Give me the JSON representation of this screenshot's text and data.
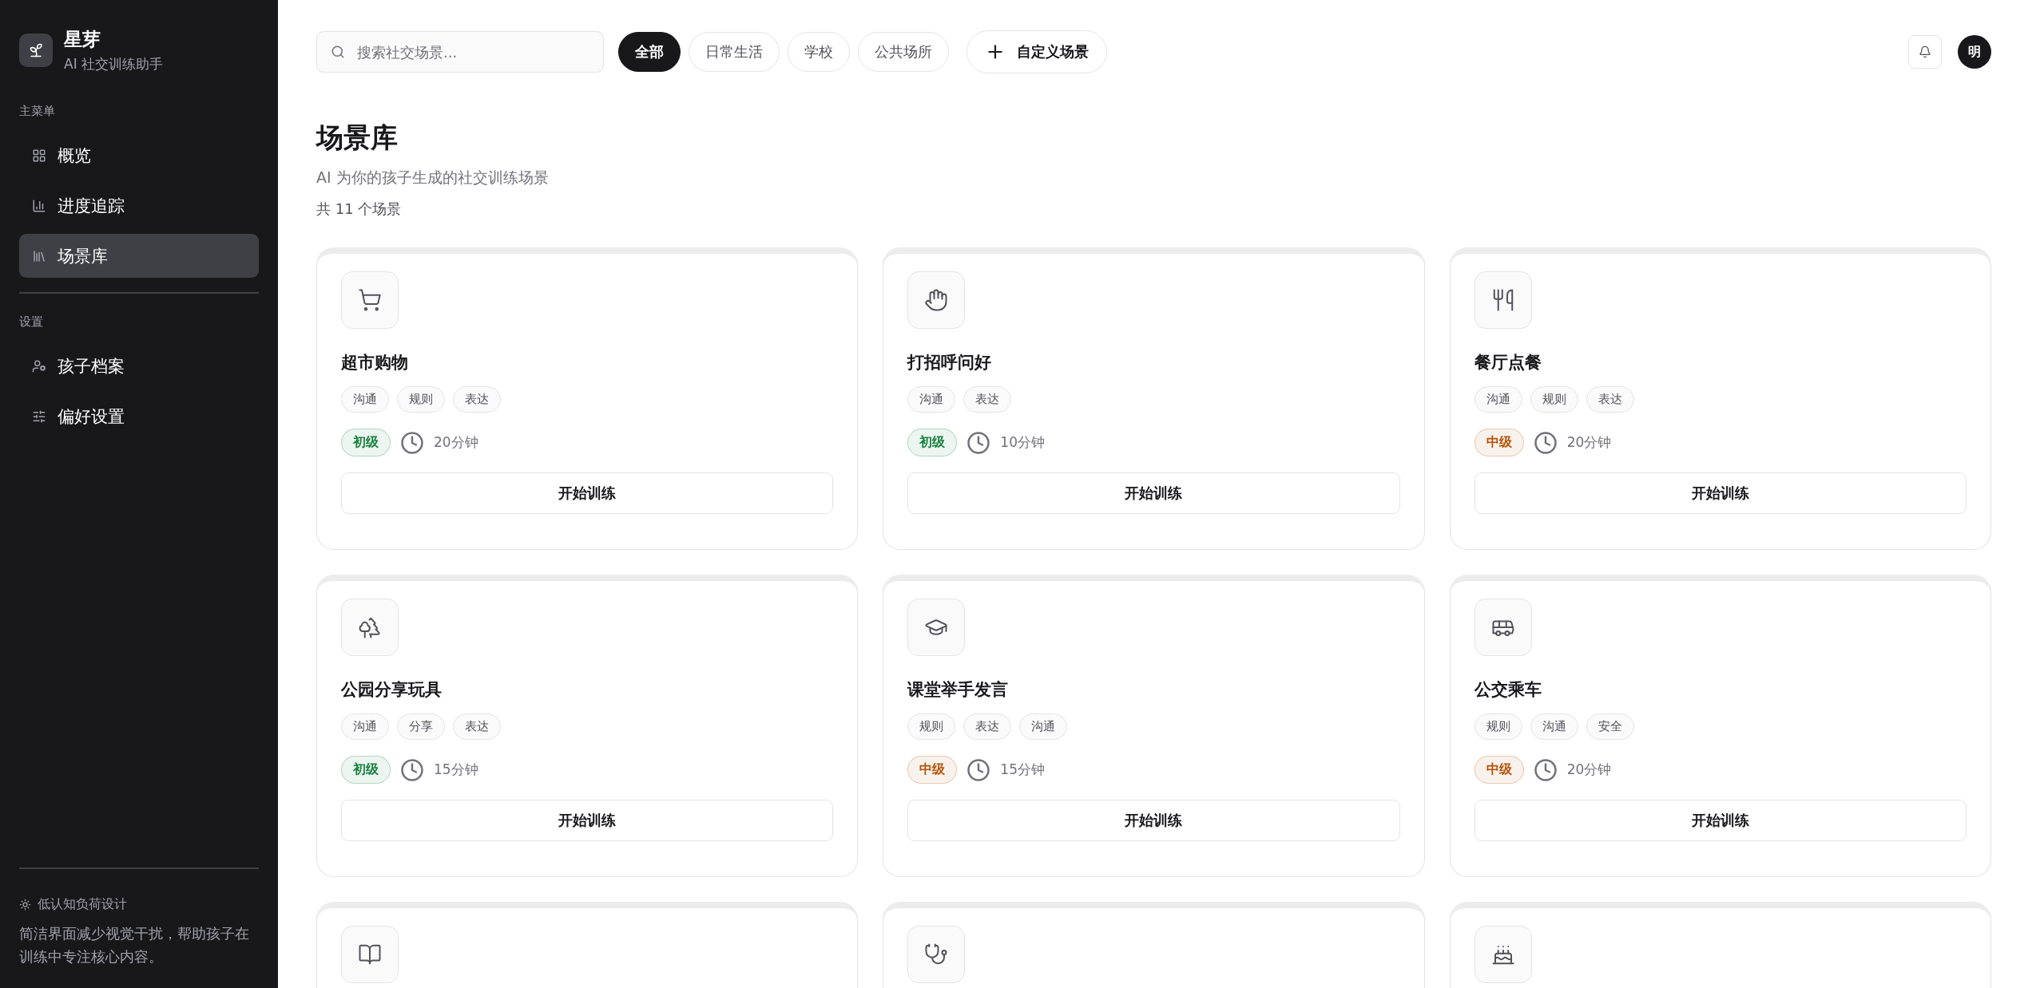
{
  "sidebar": {
    "brand": {
      "name": "星芽",
      "tagline": "AI 社交训练助手"
    },
    "sections": [
      {
        "heading": "主菜单",
        "items": [
          {
            "label": "概览",
            "selected": false
          },
          {
            "label": "进度追踪",
            "selected": false
          },
          {
            "label": "场景库",
            "selected": true
          }
        ]
      },
      {
        "heading": "设置",
        "items": [
          {
            "label": "孩子档案",
            "selected": false
          },
          {
            "label": "偏好设置",
            "selected": false
          }
        ]
      }
    ],
    "footer": {
      "title": "低认知负荷设计",
      "text": "简洁界面减少视觉干扰，帮助孩子在训练中专注核心内容。"
    }
  },
  "toolbar": {
    "search": {
      "placeholder": "搜索社交场景..."
    },
    "filters": [
      {
        "label": "全部",
        "selected": true
      },
      {
        "label": "日常生活",
        "selected": false
      },
      {
        "label": "学校",
        "selected": false
      },
      {
        "label": "公共场所",
        "selected": false
      }
    ],
    "custom_button": "自定义场景",
    "avatar": "明"
  },
  "header": {
    "title": "场景库",
    "subtitle": "AI 为你的孩子生成的社交训练场景",
    "count": "共 11 个场景"
  },
  "cards": [
    {
      "kind": "full",
      "title": "超市购物",
      "tags": [
        "沟通",
        "规则",
        "表达"
      ],
      "difficulty": {
        "label": "初级",
        "color": "#15803d"
      },
      "duration": "20分钟",
      "button": "开始训练"
    },
    {
      "kind": "full",
      "title": "打招呼问好",
      "tags": [
        "沟通",
        "表达"
      ],
      "difficulty": {
        "label": "初级",
        "color": "#15803d"
      },
      "duration": "10分钟",
      "button": "开始训练"
    },
    {
      "kind": "full",
      "title": "餐厅点餐",
      "tags": [
        "沟通",
        "规则",
        "表达"
      ],
      "difficulty": {
        "label": "中级",
        "color": "#b45309"
      },
      "duration": "20分钟",
      "button": "开始训练"
    },
    {
      "kind": "full",
      "title": "公园分享玩具",
      "tags": [
        "沟通",
        "分享",
        "表达"
      ],
      "difficulty": {
        "label": "初级",
        "color": "#15803d"
      },
      "duration": "15分钟",
      "button": "开始训练"
    },
    {
      "kind": "full",
      "title": "课堂举手发言",
      "tags": [
        "规则",
        "表达",
        "沟通"
      ],
      "difficulty": {
        "label": "中级",
        "color": "#b45309"
      },
      "duration": "15分钟",
      "button": "开始训练"
    },
    {
      "kind": "full",
      "title": "公交乘车",
      "tags": [
        "规则",
        "沟通",
        "安全"
      ],
      "difficulty": {
        "label": "中级",
        "color": "#b45309"
      },
      "duration": "20分钟",
      "button": "开始训练"
    },
    {
      "kind": "cut_off"
    },
    {
      "kind": "cut_off"
    },
    {
      "kind": "cut_off"
    }
  ]
}
